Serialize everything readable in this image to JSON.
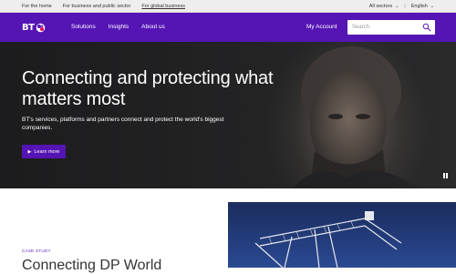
{
  "topbar": {
    "links": [
      "For the home",
      "For business and public sector",
      "For global business"
    ],
    "active_index": 2,
    "sectors": "All sectors",
    "language": "English"
  },
  "nav": {
    "logo_text": "BT",
    "menu": [
      "Solutions",
      "Insights",
      "About us"
    ],
    "account": "My Account",
    "search_placeholder": "Search"
  },
  "hero": {
    "headline": "Connecting and protecting what matters most",
    "subtext": "BT's services, platforms and partners connect and protect the world's biggest companies.",
    "cta": "Learn more"
  },
  "case_study": {
    "tag": "CASE STUDY",
    "title": "Connecting DP World"
  },
  "colors": {
    "brand_purple": "#5514b4",
    "top_bar_bg": "#eeeeee"
  }
}
